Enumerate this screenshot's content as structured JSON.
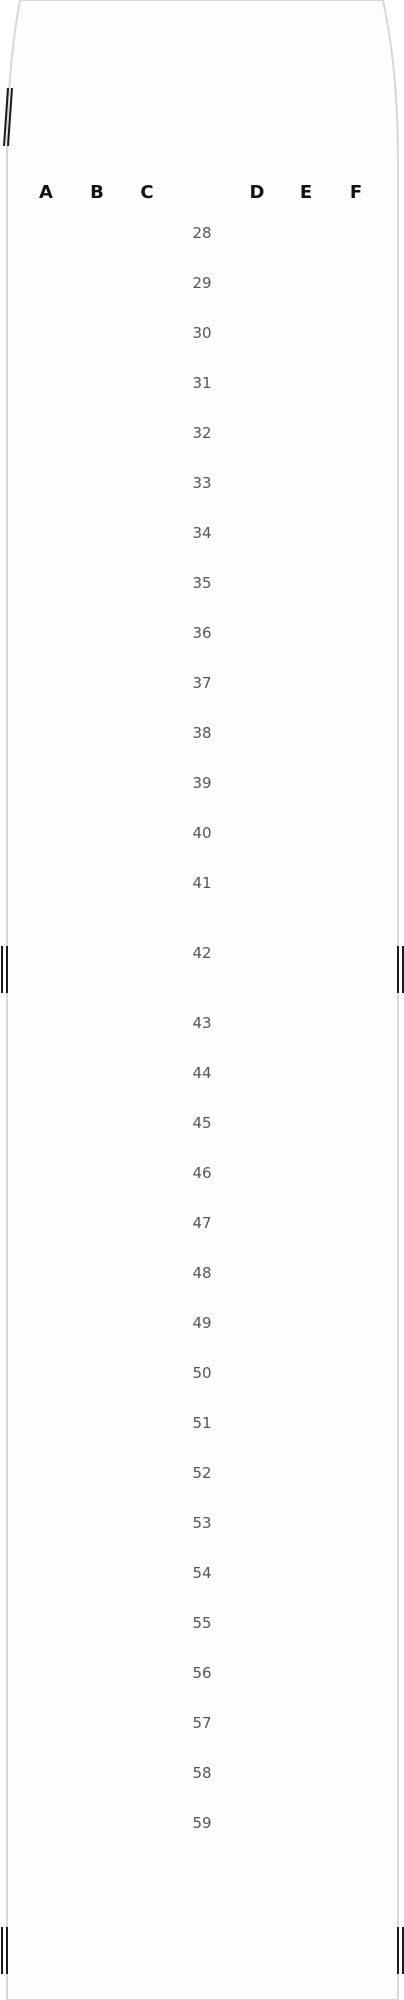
{
  "seat_map": {
    "column_headers": [
      {
        "letter": "A"
      },
      {
        "letter": "B"
      },
      {
        "letter": "C"
      },
      {
        "letter": "D"
      },
      {
        "letter": "E"
      },
      {
        "letter": "F"
      }
    ],
    "rows": [
      "28",
      "29",
      "30",
      "31",
      "32",
      "33",
      "34",
      "35",
      "36",
      "37",
      "38",
      "39",
      "40",
      "41",
      "42",
      "43",
      "44",
      "45",
      "46",
      "47",
      "48",
      "49",
      "50",
      "51",
      "52",
      "53",
      "54",
      "55",
      "56",
      "57",
      "58",
      "59"
    ],
    "exit_rows": [
      "42"
    ],
    "colors": {
      "fuselage_outline": "#d7d7d7",
      "cabin_fill": "#fdfdfd",
      "exit_marker": "#1a1a1a",
      "row_number": "#555555",
      "column_header": "#111111"
    },
    "icons": {
      "exit_marker": "exit-door-marker-icon"
    }
  }
}
